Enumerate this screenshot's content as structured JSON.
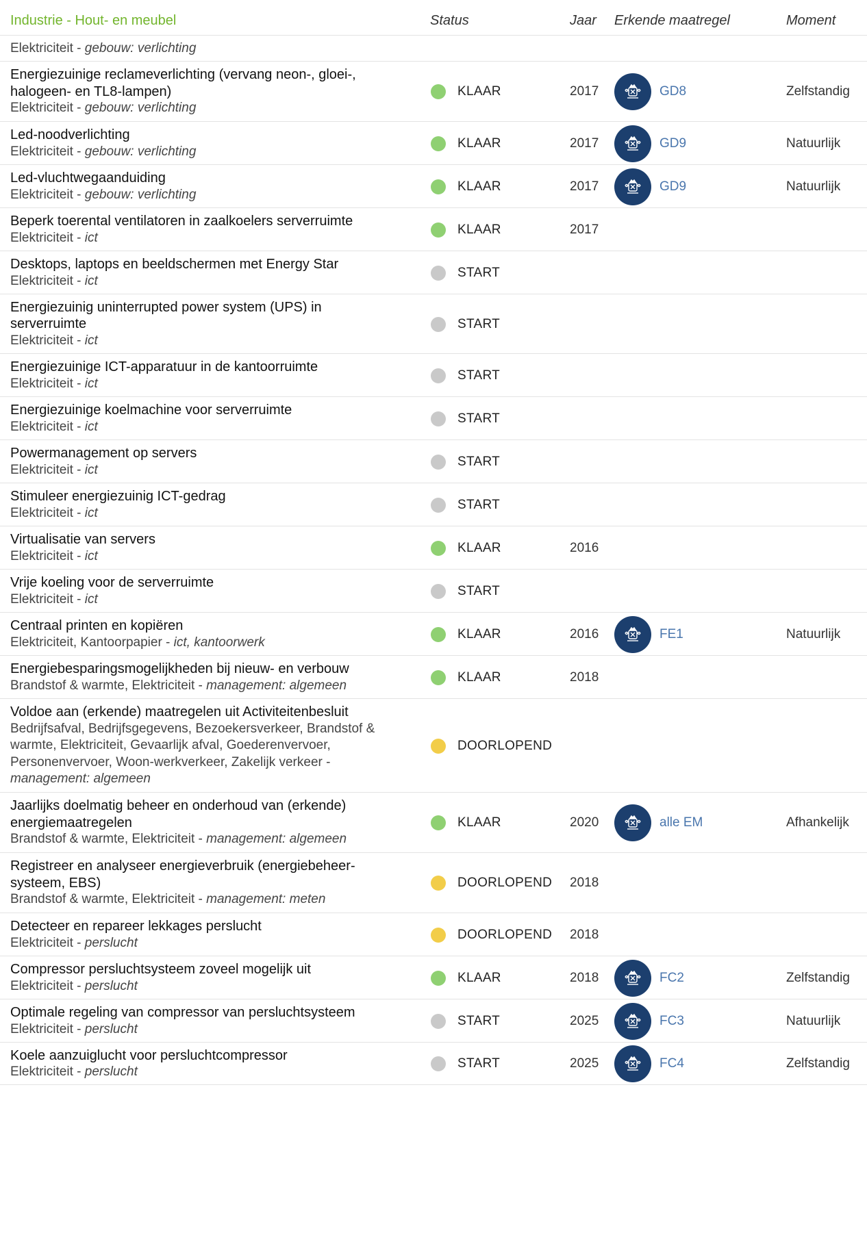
{
  "header": {
    "title": "Industrie - Hout- en meubel",
    "col_status": "Status",
    "col_year": "Jaar",
    "col_measure": "Erkende maatregel",
    "col_moment": "Moment"
  },
  "colors": {
    "accent_green_title": "#72b52c",
    "status_klaar": "#8fd072",
    "status_start": "#c9c9c9",
    "status_doorlopend": "#f2cd49",
    "seal_bg": "#1c3f6e",
    "link": "#4a76ad"
  },
  "rows": [
    {
      "lines": [],
      "cat_main": "Elektriciteit",
      "cat_sub": "gebouw: verlichting",
      "status": "",
      "year": "",
      "measure": "",
      "moment": "",
      "seal": false
    },
    {
      "lines": [
        "Energiezuinige reclameverlichting (vervang neon-, gloei-,",
        "halogeen- en TL8-lampen)"
      ],
      "cat_main": "Elektriciteit",
      "cat_sub": "gebouw: verlichting",
      "status": "KLAAR",
      "status_type": "klaar",
      "year": "2017",
      "measure": "GD8",
      "moment": "Zelfstandig",
      "seal": true
    },
    {
      "lines": [
        "Led-noodverlichting"
      ],
      "cat_main": "Elektriciteit",
      "cat_sub": "gebouw: verlichting",
      "status": "KLAAR",
      "status_type": "klaar",
      "year": "2017",
      "measure": "GD9",
      "moment": "Natuurlijk",
      "seal": true
    },
    {
      "lines": [
        "Led-vluchtwegaanduiding"
      ],
      "cat_main": "Elektriciteit",
      "cat_sub": "gebouw: verlichting",
      "status": "KLAAR",
      "status_type": "klaar",
      "year": "2017",
      "measure": "GD9",
      "moment": "Natuurlijk",
      "seal": true
    },
    {
      "lines": [
        "Beperk toerental ventilatoren in zaalkoelers serverruimte"
      ],
      "cat_main": "Elektriciteit",
      "cat_sub": "ict",
      "status": "KLAAR",
      "status_type": "klaar",
      "year": "2017",
      "measure": "",
      "moment": "",
      "seal": false
    },
    {
      "lines": [
        "Desktops, laptops en beeldschermen met Energy Star"
      ],
      "cat_main": "Elektriciteit",
      "cat_sub": "ict",
      "status": "START",
      "status_type": "start",
      "year": "",
      "measure": "",
      "moment": "",
      "seal": false
    },
    {
      "lines": [
        "Energiezuinig uninterrupted power system (UPS) in",
        "serverruimte"
      ],
      "cat_main": "Elektriciteit",
      "cat_sub": "ict",
      "status": "START",
      "status_type": "start",
      "year": "",
      "measure": "",
      "moment": "",
      "seal": false
    },
    {
      "lines": [
        "Energiezuinige ICT-apparatuur in de kantoorruimte"
      ],
      "cat_main": "Elektriciteit",
      "cat_sub": "ict",
      "status": "START",
      "status_type": "start",
      "year": "",
      "measure": "",
      "moment": "",
      "seal": false
    },
    {
      "lines": [
        "Energiezuinige koelmachine voor serverruimte"
      ],
      "cat_main": "Elektriciteit",
      "cat_sub": "ict",
      "status": "START",
      "status_type": "start",
      "year": "",
      "measure": "",
      "moment": "",
      "seal": false
    },
    {
      "lines": [
        "Powermanagement op servers"
      ],
      "cat_main": "Elektriciteit",
      "cat_sub": "ict",
      "status": "START",
      "status_type": "start",
      "year": "",
      "measure": "",
      "moment": "",
      "seal": false
    },
    {
      "lines": [
        "Stimuleer energiezuinig ICT-gedrag"
      ],
      "cat_main": "Elektriciteit",
      "cat_sub": "ict",
      "status": "START",
      "status_type": "start",
      "year": "",
      "measure": "",
      "moment": "",
      "seal": false
    },
    {
      "lines": [
        "Virtualisatie van servers"
      ],
      "cat_main": "Elektriciteit",
      "cat_sub": "ict",
      "status": "KLAAR",
      "status_type": "klaar",
      "year": "2016",
      "measure": "",
      "moment": "",
      "seal": false
    },
    {
      "lines": [
        "Vrije koeling voor de serverruimte"
      ],
      "cat_main": "Elektriciteit",
      "cat_sub": "ict",
      "status": "START",
      "status_type": "start",
      "year": "",
      "measure": "",
      "moment": "",
      "seal": false
    },
    {
      "lines": [
        "Centraal printen en kopiëren"
      ],
      "cat_main": "Elektriciteit, Kantoorpapier",
      "cat_sub": "ict, kantoorwerk",
      "status": "KLAAR",
      "status_type": "klaar",
      "year": "2016",
      "measure": "FE1",
      "moment": "Natuurlijk",
      "seal": true
    },
    {
      "lines": [
        "Energiebesparingsmogelijkheden bij nieuw- en verbouw"
      ],
      "cat_main": "Brandstof & warmte, Elektriciteit",
      "cat_sub": "management: algemeen",
      "status": "KLAAR",
      "status_type": "klaar",
      "year": "2018",
      "measure": "",
      "moment": "",
      "seal": false
    },
    {
      "lines": [
        "Voldoe aan (erkende) maatregelen uit Activiteitenbesluit"
      ],
      "cat_lines": [
        "Bedrijfsafval, Bedrijfsgegevens, Bezoekersverkeer, Brandstof &",
        "warmte, Elektriciteit, Gevaarlijk afval, Goederenvervoer,",
        "Personenvervoer, Woon-werkverkeer, Zakelijk verkeer -"
      ],
      "cat_sub_line": "management: algemeen",
      "status": "DOORLOPEND",
      "status_type": "doorlopend",
      "year": "",
      "measure": "",
      "moment": "",
      "seal": false
    },
    {
      "lines": [
        "Jaarlijks doelmatig beheer en onderhoud van (erkende)",
        "energiemaatregelen"
      ],
      "cat_main": "Brandstof & warmte, Elektriciteit",
      "cat_sub": "management: algemeen",
      "status": "KLAAR",
      "status_type": "klaar",
      "year": "2020",
      "measure": "alle EM",
      "moment": "Afhankelijk",
      "seal": true
    },
    {
      "lines": [
        "Registreer en analyseer energieverbruik (energiebeheer-",
        "systeem, EBS)"
      ],
      "cat_main": "Brandstof & warmte, Elektriciteit",
      "cat_sub": "management: meten",
      "status": "DOORLOPEND",
      "status_type": "doorlopend",
      "year": "2018",
      "measure": "",
      "moment": "",
      "seal": false
    },
    {
      "lines": [
        "Detecteer en repareer lekkages perslucht"
      ],
      "cat_main": "Elektriciteit",
      "cat_sub": "perslucht",
      "status": "DOORLOPEND",
      "status_type": "doorlopend",
      "year": "2018",
      "measure": "",
      "moment": "",
      "seal": false
    },
    {
      "lines": [
        "Compressor persluchtsysteem zoveel mogelijk uit"
      ],
      "cat_main": "Elektriciteit",
      "cat_sub": "perslucht",
      "status": "KLAAR",
      "status_type": "klaar",
      "year": "2018",
      "measure": "FC2",
      "moment": "Zelfstandig",
      "seal": true
    },
    {
      "lines": [
        "Optimale regeling van compressor van persluchtsysteem"
      ],
      "cat_main": "Elektriciteit",
      "cat_sub": "perslucht",
      "status": "START",
      "status_type": "start",
      "year": "2025",
      "measure": "FC3",
      "moment": "Natuurlijk",
      "seal": true
    },
    {
      "lines": [
        "Koele aanzuiglucht voor persluchtcompressor"
      ],
      "cat_main": "Elektriciteit",
      "cat_sub": "perslucht",
      "status": "START",
      "status_type": "start",
      "year": "2025",
      "measure": "FC4",
      "moment": "Zelfstandig",
      "seal": true
    }
  ]
}
